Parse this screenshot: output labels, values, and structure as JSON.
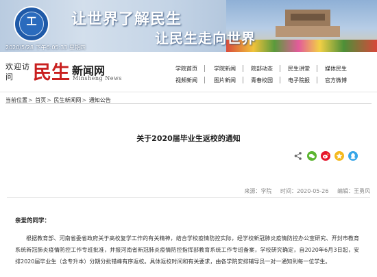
{
  "banner": {
    "logo_glyph": "工",
    "slogan_line1": "让世界了解民生",
    "slogan_line2": "让民生走向世界",
    "datetime": "2020/5/28 下午6:05:33 星期四"
  },
  "header": {
    "welcome": "欢迎访问",
    "brand_main": "民生",
    "brand_sub": "新闻网",
    "brand_en": "Minsheng News"
  },
  "nav": {
    "row1": [
      "学院首页",
      "学院新闻",
      "院部动态",
      "民生讲堂",
      "媒体民生"
    ],
    "row2": [
      "视频新闻",
      "图片新闻",
      "青春校园",
      "电子院报",
      "官方微博"
    ]
  },
  "breadcrumb": {
    "label": "当前位置",
    "items": [
      "首页",
      "民生新闻网",
      "通知公告"
    ]
  },
  "article": {
    "title": "关于2020届毕业生返校的通知",
    "source": "来源：学院",
    "time": "时间：2020-05-26",
    "editor": "编辑：王勇风",
    "greeting": "亲爱的同学：",
    "body": "根据教育部、河南省委省政府关于高校复学工作的有关精神，结合学校疫情防控实际，经学校新冠肺炎疫情防控办公室研究、开封市教育系统新冠肺炎疫情防控工作专班批准，并报河南省新冠肺炎疫情防控指挥部教育系统工作专班备案，学校研究确定，自2020年6月3日起，安排2020届毕业生（含专升本）分期分批错峰有序返校。具体返校时间和有关要求，由各学院安排辅导员一对一通知到每一位学生。"
  },
  "share_icons": [
    "share-icon",
    "wechat-icon",
    "weibo-icon",
    "qzone-icon",
    "qq-icon"
  ],
  "colors": {
    "brand_red": "#c9201f",
    "banner_blue": "#1f5aa8"
  }
}
